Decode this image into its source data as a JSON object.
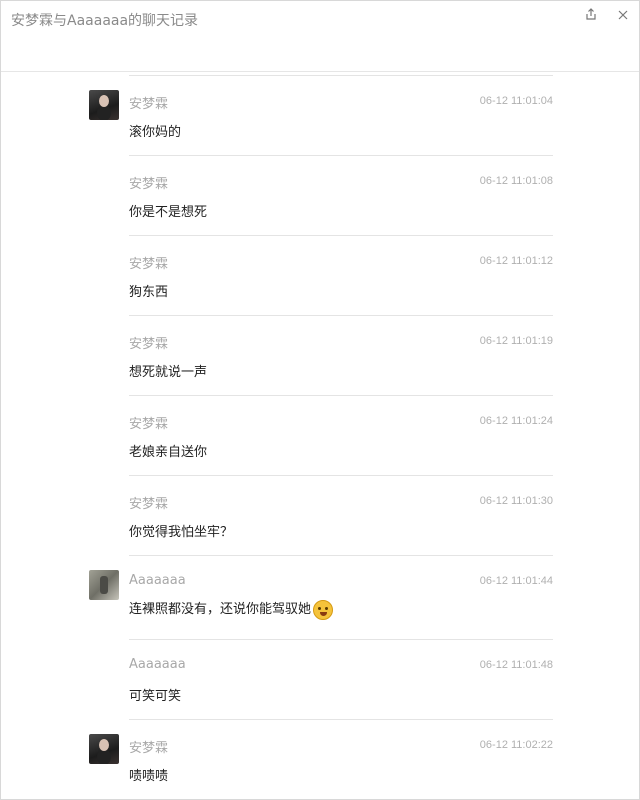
{
  "window": {
    "title": "安梦霖与Aaaaaaa的聊天记录",
    "share_icon": "share-icon",
    "close_icon": "close-icon"
  },
  "messages": [
    {
      "sender": "安梦霖",
      "time": "06-12 11:01:04",
      "text": "滚你妈的",
      "avatar": "user-anmenglin-avatar",
      "show_avatar": true
    },
    {
      "sender": "安梦霖",
      "time": "06-12 11:01:08",
      "text": "你是不是想死",
      "avatar": "",
      "show_avatar": false
    },
    {
      "sender": "安梦霖",
      "time": "06-12 11:01:12",
      "text": "狗东西",
      "avatar": "",
      "show_avatar": false
    },
    {
      "sender": "安梦霖",
      "time": "06-12 11:01:19",
      "text": "想死就说一声",
      "avatar": "",
      "show_avatar": false
    },
    {
      "sender": "安梦霖",
      "time": "06-12 11:01:24",
      "text": "老娘亲自送你",
      "avatar": "",
      "show_avatar": false
    },
    {
      "sender": "安梦霖",
      "time": "06-12 11:01:30",
      "text": "你觉得我怕坐牢？",
      "avatar": "",
      "show_avatar": false
    },
    {
      "sender": "Aaaaaaa",
      "time": "06-12 11:01:44",
      "text": "连裸照都没有，还说你能驾驭她",
      "avatar": "user-aaaaaaa-avatar",
      "show_avatar": true,
      "emoji": "drooling-face-emoji"
    },
    {
      "sender": "Aaaaaaa",
      "time": "06-12 11:01:48",
      "text": "可笑可笑",
      "avatar": "",
      "show_avatar": false
    },
    {
      "sender": "安梦霖",
      "time": "06-12 11:02:22",
      "text": "啧啧啧",
      "avatar": "user-anmenglin-avatar",
      "show_avatar": true
    }
  ]
}
